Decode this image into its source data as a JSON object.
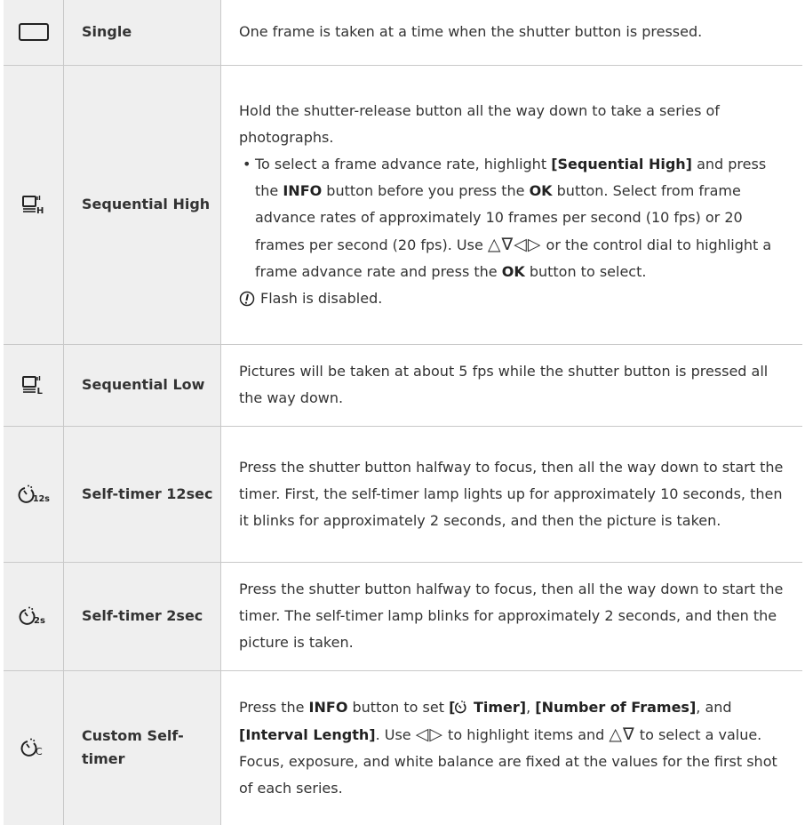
{
  "rows": [
    {
      "icon": "single-frame-icon",
      "name": "Single",
      "desc": "One frame is taken at a time when the shutter button is pressed."
    },
    {
      "icon": "sequential-high-icon",
      "name": "Sequential High",
      "intro": "Hold the shutter-release button all the way down to take a series of photographs.",
      "bullet": {
        "t1": "To select a frame advance rate, highlight ",
        "b1": "[Sequential High]",
        "t2": " and press the ",
        "b2": "INFO",
        "t3": " button before you press the ",
        "b3": "OK",
        "t4": " button. Select from frame advance rates of approximately 10 frames per second (10 fps) or 20 frames per second (20 fps). Use ",
        "arrows": "△∇◁▷",
        "t5": " or the control dial to highlight a frame advance rate and press the ",
        "b4": "OK",
        "t6": " button to select."
      },
      "caution": "Flash is disabled."
    },
    {
      "icon": "sequential-low-icon",
      "name": "Sequential Low",
      "desc": "Pictures will be taken at about 5 fps while the shutter button is pressed all the way down."
    },
    {
      "icon": "self-timer-12s-icon",
      "name": "Self-timer 12sec",
      "desc": "Press the shutter button halfway to focus, then all the way down to start the timer. First, the self-timer lamp lights up for approximately 10 seconds, then it blinks for approximately 2 seconds, and then the picture is taken."
    },
    {
      "icon": "self-timer-2s-icon",
      "name": "Self-timer 2sec",
      "desc": "Press the shutter button halfway to focus, then all the way down to start the timer. The self-timer lamp blinks for approximately 2 seconds, and then the picture is taken."
    },
    {
      "icon": "custom-self-timer-icon",
      "name": "Custom Self-timer",
      "parts": {
        "t1": "Press the ",
        "b1": "INFO",
        "t2": " button to set ",
        "b2a": "[",
        "b2b": " Timer]",
        "t3": ", ",
        "b3": "[Number of Frames]",
        "t4": ", and ",
        "b4": "[Interval Length]",
        "t5": ". Use ",
        "arrows1": "◁▷",
        "t6": " to highlight items and ",
        "arrows2": "△∇",
        "t7": " to select a value. Focus, exposure, and white balance are fixed at the values for the first shot of each series."
      }
    }
  ]
}
